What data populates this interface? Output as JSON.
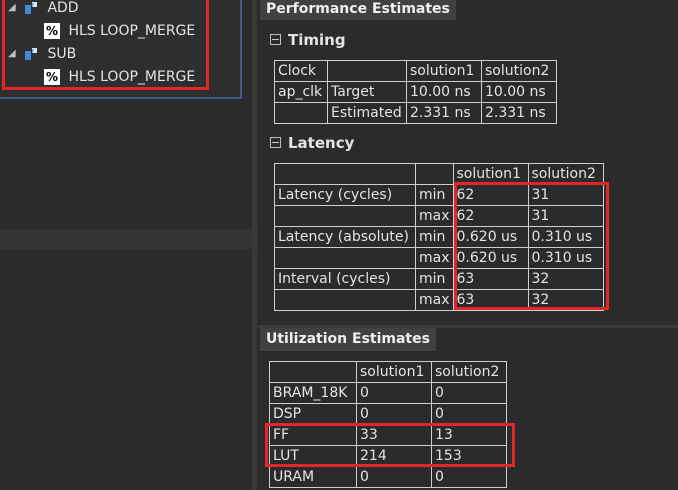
{
  "tree": {
    "items": [
      {
        "label": "ADD",
        "child": "HLS LOOP_MERGE"
      },
      {
        "label": "SUB",
        "child": "HLS LOOP_MERGE"
      }
    ],
    "pragma_symbol": "%"
  },
  "performance": {
    "header": "Performance Estimates",
    "timing": {
      "title": "Timing",
      "headers": [
        "Clock",
        "",
        "solution1",
        "solution2"
      ],
      "rows": [
        [
          "ap_clk",
          "Target",
          "10.00 ns",
          "10.00 ns"
        ],
        [
          "",
          "Estimated",
          "2.331 ns",
          "2.331 ns"
        ]
      ]
    },
    "latency": {
      "title": "Latency",
      "headers": [
        "",
        "",
        "solution1",
        "solution2"
      ],
      "rows": [
        [
          "Latency (cycles)",
          "min",
          "62",
          "31"
        ],
        [
          "",
          "max",
          "62",
          "31"
        ],
        [
          "Latency (absolute)",
          "min",
          "0.620 us",
          "0.310 us"
        ],
        [
          "",
          "max",
          "0.620 us",
          "0.310 us"
        ],
        [
          "Interval (cycles)",
          "min",
          "63",
          "32"
        ],
        [
          "",
          "max",
          "63",
          "32"
        ]
      ]
    }
  },
  "utilization": {
    "header": "Utilization Estimates",
    "headers": [
      "",
      "solution1",
      "solution2"
    ],
    "rows": [
      [
        "BRAM_18K",
        "0",
        "0"
      ],
      [
        "DSP",
        "0",
        "0"
      ],
      [
        "FF",
        "33",
        "13"
      ],
      [
        "LUT",
        "214",
        "153"
      ],
      [
        "URAM",
        "0",
        "0"
      ]
    ]
  },
  "colors": {
    "highlight": "#e0282a",
    "background": "#2b2b2b",
    "header_bg": "#414141"
  }
}
